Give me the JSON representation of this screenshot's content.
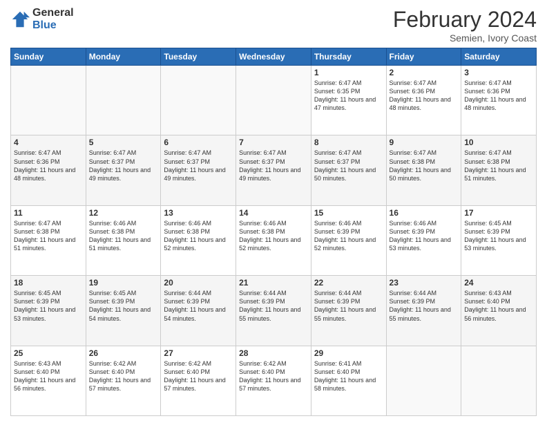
{
  "header": {
    "logo_general": "General",
    "logo_blue": "Blue",
    "month_title": "February 2024",
    "location": "Semien, Ivory Coast"
  },
  "days_of_week": [
    "Sunday",
    "Monday",
    "Tuesday",
    "Wednesday",
    "Thursday",
    "Friday",
    "Saturday"
  ],
  "weeks": [
    [
      {
        "day": "",
        "info": ""
      },
      {
        "day": "",
        "info": ""
      },
      {
        "day": "",
        "info": ""
      },
      {
        "day": "",
        "info": ""
      },
      {
        "day": "1",
        "info": "Sunrise: 6:47 AM\nSunset: 6:35 PM\nDaylight: 11 hours and 47 minutes."
      },
      {
        "day": "2",
        "info": "Sunrise: 6:47 AM\nSunset: 6:36 PM\nDaylight: 11 hours and 48 minutes."
      },
      {
        "day": "3",
        "info": "Sunrise: 6:47 AM\nSunset: 6:36 PM\nDaylight: 11 hours and 48 minutes."
      }
    ],
    [
      {
        "day": "4",
        "info": "Sunrise: 6:47 AM\nSunset: 6:36 PM\nDaylight: 11 hours and 48 minutes."
      },
      {
        "day": "5",
        "info": "Sunrise: 6:47 AM\nSunset: 6:37 PM\nDaylight: 11 hours and 49 minutes."
      },
      {
        "day": "6",
        "info": "Sunrise: 6:47 AM\nSunset: 6:37 PM\nDaylight: 11 hours and 49 minutes."
      },
      {
        "day": "7",
        "info": "Sunrise: 6:47 AM\nSunset: 6:37 PM\nDaylight: 11 hours and 49 minutes."
      },
      {
        "day": "8",
        "info": "Sunrise: 6:47 AM\nSunset: 6:37 PM\nDaylight: 11 hours and 50 minutes."
      },
      {
        "day": "9",
        "info": "Sunrise: 6:47 AM\nSunset: 6:38 PM\nDaylight: 11 hours and 50 minutes."
      },
      {
        "day": "10",
        "info": "Sunrise: 6:47 AM\nSunset: 6:38 PM\nDaylight: 11 hours and 51 minutes."
      }
    ],
    [
      {
        "day": "11",
        "info": "Sunrise: 6:47 AM\nSunset: 6:38 PM\nDaylight: 11 hours and 51 minutes."
      },
      {
        "day": "12",
        "info": "Sunrise: 6:46 AM\nSunset: 6:38 PM\nDaylight: 11 hours and 51 minutes."
      },
      {
        "day": "13",
        "info": "Sunrise: 6:46 AM\nSunset: 6:38 PM\nDaylight: 11 hours and 52 minutes."
      },
      {
        "day": "14",
        "info": "Sunrise: 6:46 AM\nSunset: 6:38 PM\nDaylight: 11 hours and 52 minutes."
      },
      {
        "day": "15",
        "info": "Sunrise: 6:46 AM\nSunset: 6:39 PM\nDaylight: 11 hours and 52 minutes."
      },
      {
        "day": "16",
        "info": "Sunrise: 6:46 AM\nSunset: 6:39 PM\nDaylight: 11 hours and 53 minutes."
      },
      {
        "day": "17",
        "info": "Sunrise: 6:45 AM\nSunset: 6:39 PM\nDaylight: 11 hours and 53 minutes."
      }
    ],
    [
      {
        "day": "18",
        "info": "Sunrise: 6:45 AM\nSunset: 6:39 PM\nDaylight: 11 hours and 53 minutes."
      },
      {
        "day": "19",
        "info": "Sunrise: 6:45 AM\nSunset: 6:39 PM\nDaylight: 11 hours and 54 minutes."
      },
      {
        "day": "20",
        "info": "Sunrise: 6:44 AM\nSunset: 6:39 PM\nDaylight: 11 hours and 54 minutes."
      },
      {
        "day": "21",
        "info": "Sunrise: 6:44 AM\nSunset: 6:39 PM\nDaylight: 11 hours and 55 minutes."
      },
      {
        "day": "22",
        "info": "Sunrise: 6:44 AM\nSunset: 6:39 PM\nDaylight: 11 hours and 55 minutes."
      },
      {
        "day": "23",
        "info": "Sunrise: 6:44 AM\nSunset: 6:39 PM\nDaylight: 11 hours and 55 minutes."
      },
      {
        "day": "24",
        "info": "Sunrise: 6:43 AM\nSunset: 6:40 PM\nDaylight: 11 hours and 56 minutes."
      }
    ],
    [
      {
        "day": "25",
        "info": "Sunrise: 6:43 AM\nSunset: 6:40 PM\nDaylight: 11 hours and 56 minutes."
      },
      {
        "day": "26",
        "info": "Sunrise: 6:42 AM\nSunset: 6:40 PM\nDaylight: 11 hours and 57 minutes."
      },
      {
        "day": "27",
        "info": "Sunrise: 6:42 AM\nSunset: 6:40 PM\nDaylight: 11 hours and 57 minutes."
      },
      {
        "day": "28",
        "info": "Sunrise: 6:42 AM\nSunset: 6:40 PM\nDaylight: 11 hours and 57 minutes."
      },
      {
        "day": "29",
        "info": "Sunrise: 6:41 AM\nSunset: 6:40 PM\nDaylight: 11 hours and 58 minutes."
      },
      {
        "day": "",
        "info": ""
      },
      {
        "day": "",
        "info": ""
      }
    ]
  ]
}
